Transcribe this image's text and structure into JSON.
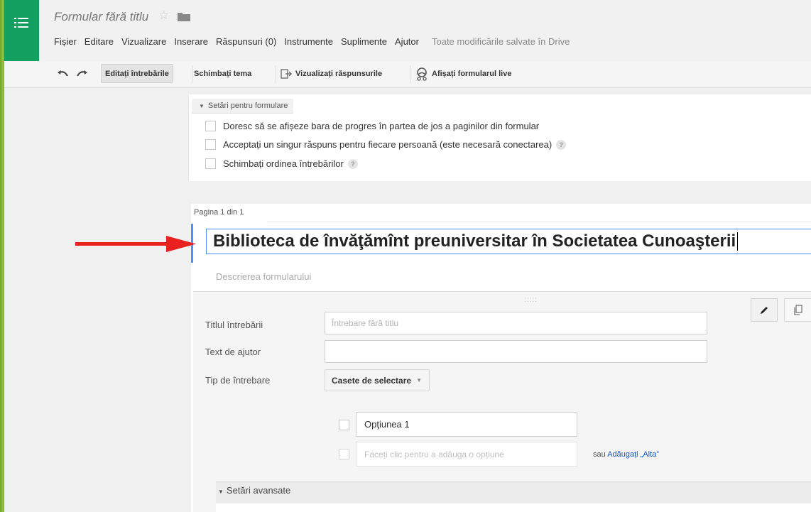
{
  "header": {
    "doc_title": "Formular fără titlu",
    "menu": [
      "Fișier",
      "Editare",
      "Vizualizare",
      "Inserare",
      "Răspunsuri (0)",
      "Instrumente",
      "Suplimente",
      "Ajutor"
    ],
    "saved_status": "Toate modificările salvate în Drive"
  },
  "toolbar": {
    "edit_questions": "Editați întrebările",
    "change_theme": "Schimbați tema",
    "view_responses": "Vizualizați răspunsurile",
    "view_live": "Afișați formularul live"
  },
  "settings": {
    "tab_label": "Setări pentru formulare",
    "options": [
      "Doresc să se afișeze bara de progres în partea de jos a paginilor din formular",
      "Acceptați un singur răspuns pentru fiecare persoană (este necesară conectarea)",
      "Schimbați ordinea întrebărilor"
    ]
  },
  "form": {
    "page_label": "Pagina 1 din 1",
    "title": "Biblioteca de învăţămînt preuniversitar în Societatea Cunoaşterii",
    "description_placeholder": "Descrierea formularului"
  },
  "question": {
    "drag_handle": ":::::",
    "title_label": "Titlul întrebării",
    "title_placeholder": "Întrebare fără titlu",
    "help_label": "Text de ajutor",
    "help_value": "",
    "type_label": "Tip de întrebare",
    "type_value": "Casete de selectare",
    "option_1": "Opţiunea 1",
    "add_option_placeholder": "Faceți clic pentru a adăuga o opțiune",
    "or_text": "sau",
    "add_other_link": "Adăugați „Alta”",
    "advanced_label": "Setări avansate"
  },
  "help_mark": "?",
  "colors": {
    "accent": "#4d90fe",
    "brand_green": "#129f5f",
    "annotation_red": "#e8201f"
  }
}
